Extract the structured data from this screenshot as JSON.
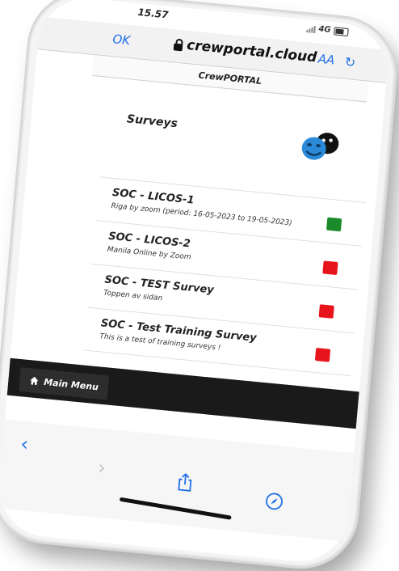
{
  "status": {
    "time": "15.57",
    "network": "4G"
  },
  "browser": {
    "done_label": "OK",
    "host": "crewportal.cloud",
    "aa_label": "AA",
    "reload_icon": "reload-icon",
    "accent": "#1f6ee8"
  },
  "site": {
    "title": "CrewPORTAL"
  },
  "page": {
    "heading": "Surveys",
    "icon": "theater-masks-icon"
  },
  "surveys": [
    {
      "name": "SOC - LICOS-1",
      "desc": "Riga by zoom (period: 16-05-2023 to 19-05-2023)",
      "status_color": "#1a8a2a"
    },
    {
      "name": "SOC - LICOS-2",
      "desc": "Manila Online by Zoom",
      "status_color": "#e8141c"
    },
    {
      "name": "SOC - TEST Survey",
      "desc": "Toppen av sidan",
      "status_color": "#e8141c"
    },
    {
      "name": "SOC - Test Training Survey",
      "desc": "This is a test of training surveys !",
      "status_color": "#e8141c"
    }
  ],
  "menu": {
    "main_menu_label": "Main Menu",
    "bar_color": "#1a1a1a"
  },
  "toolbar": {
    "back_icon": "back-chevron-icon",
    "forward_icon": "forward-chevron-icon",
    "share_icon": "share-icon",
    "compass_icon": "compass-icon"
  }
}
